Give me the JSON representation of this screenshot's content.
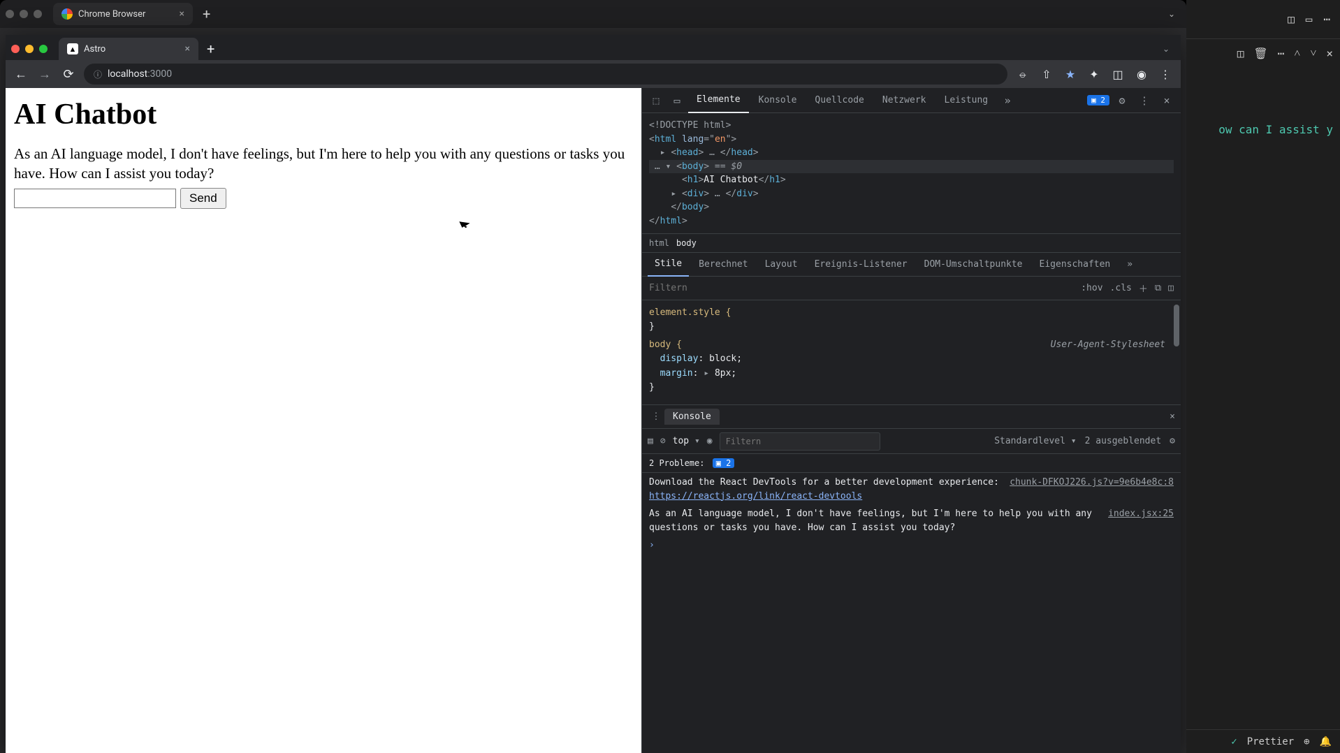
{
  "outer": {
    "tab_title": "Chrome Browser"
  },
  "chrome": {
    "tab_title": "Astro",
    "url_host": "localhost",
    "url_port": ":3000"
  },
  "page": {
    "h1": "AI Chatbot",
    "reply": "As an AI language model, I don't have feelings, but I'm here to help you with any questions or tasks you have. How can I assist you today?",
    "send": "Send"
  },
  "devtools": {
    "tabs": {
      "elements": "Elemente",
      "console": "Konsole",
      "sources": "Quellcode",
      "network": "Netzwerk",
      "performance": "Leistung"
    },
    "issues_badge": "2",
    "dom": {
      "doctype": "<!DOCTYPE html>",
      "html_open": "<html lang=\"en\">",
      "head": "<head> … </head>",
      "body_open": "<body>",
      "body_hint": " == $0",
      "h1_open": "<h1>",
      "h1_text": "AI Chatbot",
      "h1_close": "</h1>",
      "div": "<div> … </div>",
      "body_close": "</body>",
      "html_close": "</html>"
    },
    "breadcrumb": {
      "a": "html",
      "b": "body"
    },
    "styles_tabs": {
      "styles": "Stile",
      "computed": "Berechnet",
      "layout": "Layout",
      "listeners": "Ereignis-Listener",
      "dom_bp": "DOM-Umschaltpunkte",
      "props": "Eigenschaften"
    },
    "filter_placeholder": "Filtern",
    "hov": ":hov",
    "cls": ".cls",
    "styles_body": {
      "elstyle": "element.style {",
      "close1": "}",
      "body_sel": "body {",
      "ua": "User-Agent-Stylesheet",
      "p1": "display",
      "v1": "block",
      "p2": "margin",
      "v2": "8px",
      "close2": "}"
    },
    "drawer_title": "Konsole",
    "console_tb": {
      "ctx": "top",
      "filter_placeholder": "Filtern",
      "level": "Standardlevel",
      "hidden": "2 ausgeblendet"
    },
    "problems_label": "2 Probleme:",
    "problems_badge": "2",
    "console": {
      "src1": "chunk-DFKOJ226.js?v=9e6b4e8c:8",
      "msg1a": "Download the React DevTools for a better development experience: ",
      "msg1b": "https://reactjs.org/link/react-devtools",
      "src2": "index.jsx:25",
      "msg2": "As an AI language model, I don't have feelings, but I'm here to help you with any questions or tasks you have. How can I assist you today?"
    }
  },
  "editor": {
    "snippet": "ow can I assist y",
    "status": "Prettier"
  }
}
